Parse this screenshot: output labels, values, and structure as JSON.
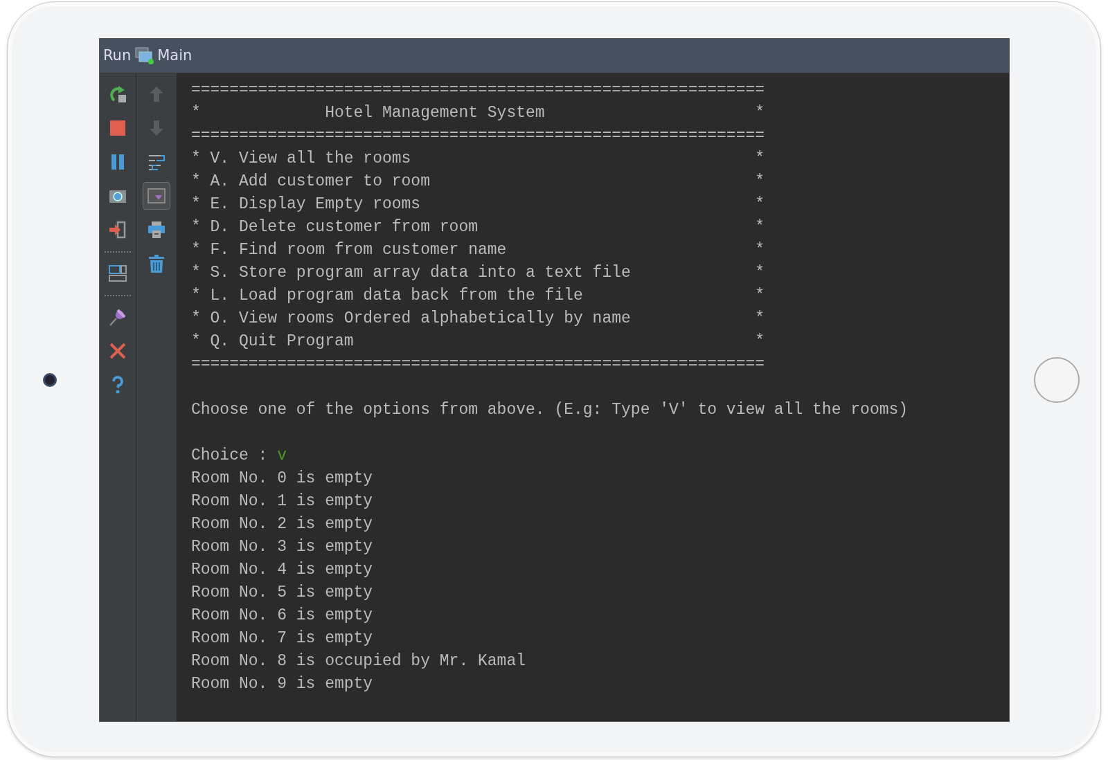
{
  "window": {
    "title": "Run",
    "tab": "Main"
  },
  "toolbar_secondary": [
    {
      "disabled": true,
      "on": false
    },
    {
      "disabled": true,
      "on": false
    },
    {
      "disabled": false,
      "on": false
    },
    {
      "disabled": false,
      "on": true
    },
    {
      "disabled": false,
      "on": false
    },
    {
      "disabled": false,
      "on": false
    }
  ],
  "console": {
    "banner": [
      "============================================================",
      "*             Hotel Management System                      *",
      "============================================================",
      "* V. View all the rooms                                    *",
      "* A. Add customer to room                                  *",
      "* E. Display Empty rooms                                   *",
      "* D. Delete customer from room                             *",
      "* F. Find room from customer name                          *",
      "* S. Store program array data into a text file             *",
      "* L. Load program data back from the file                  *",
      "* O. View rooms Ordered alphabetically by name             *",
      "* Q. Quit Program                                          *",
      "============================================================"
    ],
    "instruction": "Choose one of the options from above. (E.g: Type 'V' to view all the rooms)",
    "prompt": "Choice : ",
    "input": "v",
    "output": [
      "Room No. 0 is empty",
      "Room No. 1 is empty",
      "Room No. 2 is empty",
      "Room No. 3 is empty",
      "Room No. 4 is empty",
      "Room No. 5 is empty",
      "Room No. 6 is empty",
      "Room No. 7 is empty",
      "Room No. 8 is occupied by Mr. Kamal",
      "Room No. 9 is empty"
    ]
  }
}
